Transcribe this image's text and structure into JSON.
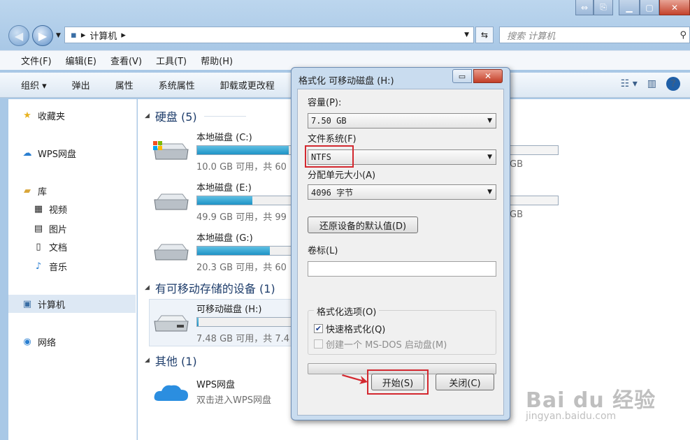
{
  "window": {
    "address": {
      "segments": [
        "计算机"
      ]
    },
    "search_placeholder": "搜索 计算机",
    "menus": [
      "文件(F)",
      "编辑(E)",
      "查看(V)",
      "工具(T)",
      "帮助(H)"
    ],
    "commands": [
      "组织 ▾",
      "弹出",
      "属性",
      "系统属性",
      "卸载或更改程"
    ]
  },
  "sidebar": {
    "favorites": "收藏夹",
    "wps": "WPS网盘",
    "library": "库",
    "library_items": [
      "视频",
      "图片",
      "文档",
      "音乐"
    ],
    "computer": "计算机",
    "network": "网络"
  },
  "content": {
    "groups": {
      "hard_disks": "硬盘 (5)",
      "removable": "有可移动存储的设备 (1)",
      "other": "其他 (1)"
    },
    "drives": [
      {
        "name": "本地磁盘 (C:)",
        "free": "10.0 GB 可用，共 60",
        "used_fraction": 0.83
      },
      {
        "name": "本地磁盘 (E:)",
        "free": "49.9 GB 可用，共 99",
        "used_fraction": 0.5
      },
      {
        "name": "本地磁盘 (G:)",
        "free": "20.3 GB 可用，共 60",
        "used_fraction": 0.66
      }
    ],
    "right_column": {
      "gb1": "GB",
      "gb2": "GB"
    },
    "removable_drive": {
      "name": "可移动磁盘 (H:)",
      "free": "7.48 GB 可用，共 7.4",
      "used_fraction": 0.01
    },
    "other_item": {
      "name": "WPS网盘",
      "desc": "双击进入WPS网盘"
    }
  },
  "dialog": {
    "title": "格式化 可移动磁盘 (H:)",
    "close_glyph": "✕",
    "capacity_label": "容量(P):",
    "capacity_value": "7.50 GB",
    "fs_label": "文件系统(F)",
    "fs_value": "NTFS",
    "alloc_label": "分配单元大小(A)",
    "alloc_value": "4096 字节",
    "restore_button": "还原设备的默认值(D)",
    "volume_label": "卷标(L)",
    "volume_value": "",
    "options_legend": "格式化选项(O)",
    "quick_format": "快速格式化(Q)",
    "msdos_disk": "创建一个 MS-DOS 启动盘(M)",
    "start_button": "开始(S)",
    "close_button": "关闭(C)"
  },
  "watermark": {
    "brand": "Bai du 经验",
    "url": "jingyan.baidu.com"
  },
  "colors": {
    "highlight": "#d3282f",
    "bar": "#1e93c6",
    "accent": "#1f5fa7"
  }
}
